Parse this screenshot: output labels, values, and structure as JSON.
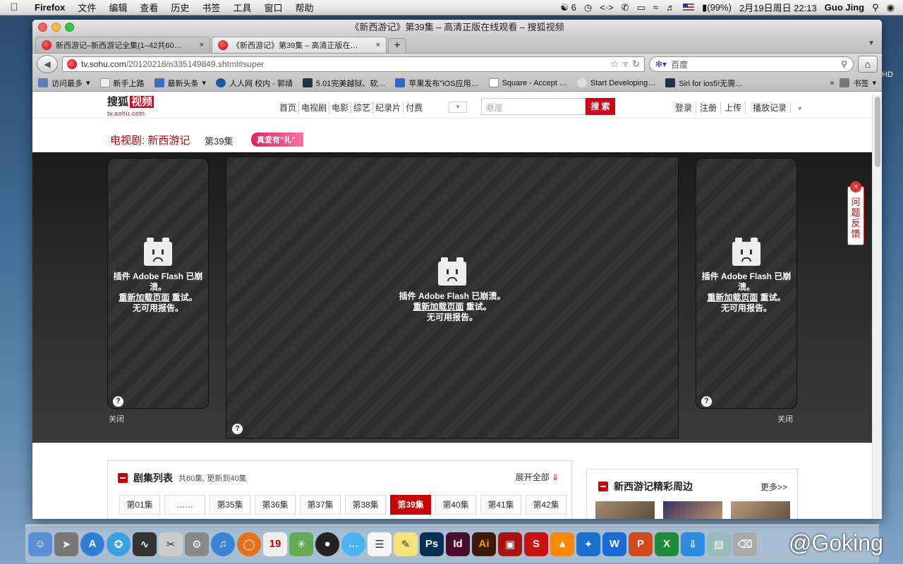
{
  "menubar": {
    "app": "Firefox",
    "items": [
      "文件",
      "编辑",
      "查看",
      "历史",
      "书签",
      "工具",
      "窗口",
      "帮助"
    ],
    "status": {
      "adium": "6",
      "battery": "(99%)",
      "datetime": "2月19日周日  22:13",
      "user": "Guo Jing"
    }
  },
  "window": {
    "title": "《新西游记》第39集 – 高清正版在线观看 – 搜狐视频"
  },
  "tabs": [
    {
      "label": "新西游记–新西游记全集(1–42共60…"
    },
    {
      "label": "《新西游记》第39集 – 高清正版在…"
    }
  ],
  "nav": {
    "url_prefix": "tv.sohu.com",
    "url_rest": "/20120218/n335149849.shtml#super",
    "search_engine": "百度"
  },
  "bookmarks": [
    "访问最多",
    "新手上路",
    "最新头条",
    "人人网 校内 - 郭靖",
    "5.01完美越狱、软…",
    "苹果发布\"iOS应用…",
    "Square - Accept …",
    "Start Developing…",
    "Siri for ios5!无需…",
    "书签"
  ],
  "site": {
    "logo": "搜狐",
    "logo_v": "视频",
    "logo_sub": "tv.sohu.com",
    "topnav": [
      "首页",
      "电视剧",
      "电影",
      "综艺",
      "纪录片",
      "付费"
    ],
    "search_placeholder": "悬崖",
    "search_button": "搜 索",
    "userlinks": [
      "登录",
      "注册",
      "上传",
      "播放记录"
    ]
  },
  "crumb": {
    "show": "电视剧: 新西游记",
    "episode": "第39集",
    "badge": "真爱有\"礼\""
  },
  "player": {
    "main_line1": "插件 Adobe Flash 已崩溃。",
    "side_line1": "插件 Adobe Flash 已崩",
    "side_line1b": "溃。",
    "reload": "重新加载页面",
    "retry": " 重试。",
    "no_report": "无可用报告。",
    "close": "关闭",
    "help": "?"
  },
  "feedback": {
    "label": "问题反馈"
  },
  "episodes": {
    "title": "剧集列表",
    "meta": "共60集, 更新到40集",
    "expand": "展开全部",
    "items": [
      "第01集",
      "……",
      "第35集",
      "第36集",
      "第37集",
      "第38集",
      "第39集",
      "第40集",
      "第41集",
      "第42集"
    ],
    "current": "第39集"
  },
  "around": {
    "title": "新西游记精彩周边",
    "more": "更多>>"
  },
  "watermark": "@Goking",
  "edge_label": "HD"
}
